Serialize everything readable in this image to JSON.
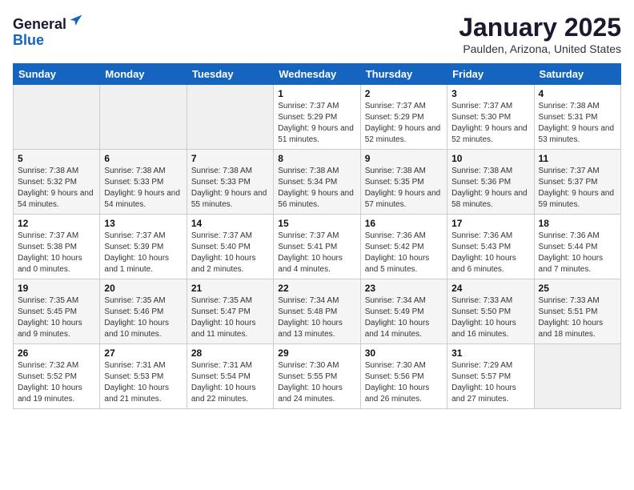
{
  "header": {
    "logo_line1": "General",
    "logo_line2": "Blue",
    "month_title": "January 2025",
    "location": "Paulden, Arizona, United States"
  },
  "weekdays": [
    "Sunday",
    "Monday",
    "Tuesday",
    "Wednesday",
    "Thursday",
    "Friday",
    "Saturday"
  ],
  "weeks": [
    [
      {
        "day": "",
        "sunrise": "",
        "sunset": "",
        "daylight": ""
      },
      {
        "day": "",
        "sunrise": "",
        "sunset": "",
        "daylight": ""
      },
      {
        "day": "",
        "sunrise": "",
        "sunset": "",
        "daylight": ""
      },
      {
        "day": "1",
        "sunrise": "Sunrise: 7:37 AM",
        "sunset": "Sunset: 5:29 PM",
        "daylight": "Daylight: 9 hours and 51 minutes."
      },
      {
        "day": "2",
        "sunrise": "Sunrise: 7:37 AM",
        "sunset": "Sunset: 5:29 PM",
        "daylight": "Daylight: 9 hours and 52 minutes."
      },
      {
        "day": "3",
        "sunrise": "Sunrise: 7:37 AM",
        "sunset": "Sunset: 5:30 PM",
        "daylight": "Daylight: 9 hours and 52 minutes."
      },
      {
        "day": "4",
        "sunrise": "Sunrise: 7:38 AM",
        "sunset": "Sunset: 5:31 PM",
        "daylight": "Daylight: 9 hours and 53 minutes."
      }
    ],
    [
      {
        "day": "5",
        "sunrise": "Sunrise: 7:38 AM",
        "sunset": "Sunset: 5:32 PM",
        "daylight": "Daylight: 9 hours and 54 minutes."
      },
      {
        "day": "6",
        "sunrise": "Sunrise: 7:38 AM",
        "sunset": "Sunset: 5:33 PM",
        "daylight": "Daylight: 9 hours and 54 minutes."
      },
      {
        "day": "7",
        "sunrise": "Sunrise: 7:38 AM",
        "sunset": "Sunset: 5:33 PM",
        "daylight": "Daylight: 9 hours and 55 minutes."
      },
      {
        "day": "8",
        "sunrise": "Sunrise: 7:38 AM",
        "sunset": "Sunset: 5:34 PM",
        "daylight": "Daylight: 9 hours and 56 minutes."
      },
      {
        "day": "9",
        "sunrise": "Sunrise: 7:38 AM",
        "sunset": "Sunset: 5:35 PM",
        "daylight": "Daylight: 9 hours and 57 minutes."
      },
      {
        "day": "10",
        "sunrise": "Sunrise: 7:38 AM",
        "sunset": "Sunset: 5:36 PM",
        "daylight": "Daylight: 9 hours and 58 minutes."
      },
      {
        "day": "11",
        "sunrise": "Sunrise: 7:37 AM",
        "sunset": "Sunset: 5:37 PM",
        "daylight": "Daylight: 9 hours and 59 minutes."
      }
    ],
    [
      {
        "day": "12",
        "sunrise": "Sunrise: 7:37 AM",
        "sunset": "Sunset: 5:38 PM",
        "daylight": "Daylight: 10 hours and 0 minutes."
      },
      {
        "day": "13",
        "sunrise": "Sunrise: 7:37 AM",
        "sunset": "Sunset: 5:39 PM",
        "daylight": "Daylight: 10 hours and 1 minute."
      },
      {
        "day": "14",
        "sunrise": "Sunrise: 7:37 AM",
        "sunset": "Sunset: 5:40 PM",
        "daylight": "Daylight: 10 hours and 2 minutes."
      },
      {
        "day": "15",
        "sunrise": "Sunrise: 7:37 AM",
        "sunset": "Sunset: 5:41 PM",
        "daylight": "Daylight: 10 hours and 4 minutes."
      },
      {
        "day": "16",
        "sunrise": "Sunrise: 7:36 AM",
        "sunset": "Sunset: 5:42 PM",
        "daylight": "Daylight: 10 hours and 5 minutes."
      },
      {
        "day": "17",
        "sunrise": "Sunrise: 7:36 AM",
        "sunset": "Sunset: 5:43 PM",
        "daylight": "Daylight: 10 hours and 6 minutes."
      },
      {
        "day": "18",
        "sunrise": "Sunrise: 7:36 AM",
        "sunset": "Sunset: 5:44 PM",
        "daylight": "Daylight: 10 hours and 7 minutes."
      }
    ],
    [
      {
        "day": "19",
        "sunrise": "Sunrise: 7:35 AM",
        "sunset": "Sunset: 5:45 PM",
        "daylight": "Daylight: 10 hours and 9 minutes."
      },
      {
        "day": "20",
        "sunrise": "Sunrise: 7:35 AM",
        "sunset": "Sunset: 5:46 PM",
        "daylight": "Daylight: 10 hours and 10 minutes."
      },
      {
        "day": "21",
        "sunrise": "Sunrise: 7:35 AM",
        "sunset": "Sunset: 5:47 PM",
        "daylight": "Daylight: 10 hours and 11 minutes."
      },
      {
        "day": "22",
        "sunrise": "Sunrise: 7:34 AM",
        "sunset": "Sunset: 5:48 PM",
        "daylight": "Daylight: 10 hours and 13 minutes."
      },
      {
        "day": "23",
        "sunrise": "Sunrise: 7:34 AM",
        "sunset": "Sunset: 5:49 PM",
        "daylight": "Daylight: 10 hours and 14 minutes."
      },
      {
        "day": "24",
        "sunrise": "Sunrise: 7:33 AM",
        "sunset": "Sunset: 5:50 PM",
        "daylight": "Daylight: 10 hours and 16 minutes."
      },
      {
        "day": "25",
        "sunrise": "Sunrise: 7:33 AM",
        "sunset": "Sunset: 5:51 PM",
        "daylight": "Daylight: 10 hours and 18 minutes."
      }
    ],
    [
      {
        "day": "26",
        "sunrise": "Sunrise: 7:32 AM",
        "sunset": "Sunset: 5:52 PM",
        "daylight": "Daylight: 10 hours and 19 minutes."
      },
      {
        "day": "27",
        "sunrise": "Sunrise: 7:31 AM",
        "sunset": "Sunset: 5:53 PM",
        "daylight": "Daylight: 10 hours and 21 minutes."
      },
      {
        "day": "28",
        "sunrise": "Sunrise: 7:31 AM",
        "sunset": "Sunset: 5:54 PM",
        "daylight": "Daylight: 10 hours and 22 minutes."
      },
      {
        "day": "29",
        "sunrise": "Sunrise: 7:30 AM",
        "sunset": "Sunset: 5:55 PM",
        "daylight": "Daylight: 10 hours and 24 minutes."
      },
      {
        "day": "30",
        "sunrise": "Sunrise: 7:30 AM",
        "sunset": "Sunset: 5:56 PM",
        "daylight": "Daylight: 10 hours and 26 minutes."
      },
      {
        "day": "31",
        "sunrise": "Sunrise: 7:29 AM",
        "sunset": "Sunset: 5:57 PM",
        "daylight": "Daylight: 10 hours and 27 minutes."
      },
      {
        "day": "",
        "sunrise": "",
        "sunset": "",
        "daylight": ""
      }
    ]
  ]
}
